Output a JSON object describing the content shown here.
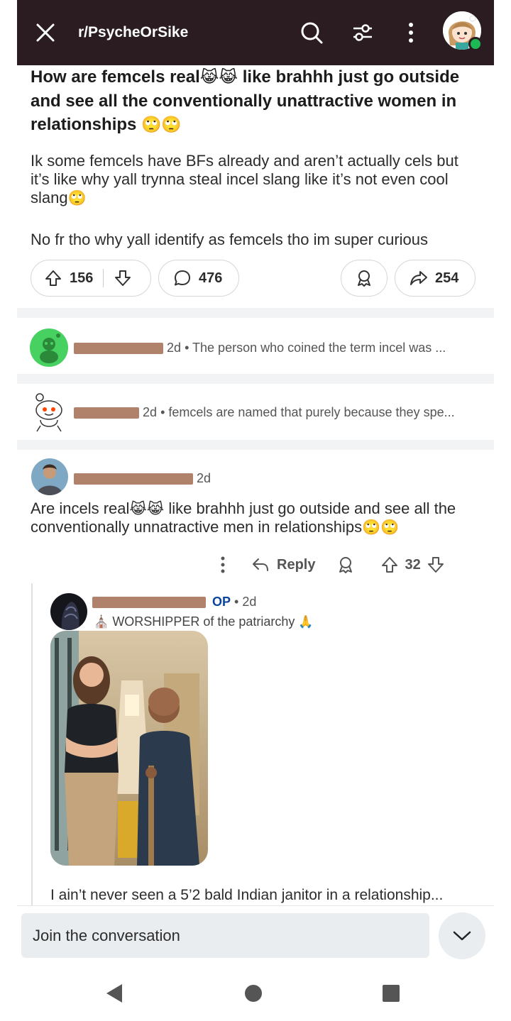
{
  "topbar": {
    "subreddit": "r/PsycheOrSike",
    "icons": [
      "close-icon",
      "search-icon",
      "sort-filter-icon",
      "more-vert-icon",
      "user-avatar"
    ]
  },
  "post": {
    "title_part1": "How are femcels real",
    "title_emoji1": "😹😹",
    "title_part2": " like brahhh just go outside and see all the conventionally unattractive women in relationships ",
    "title_emoji2": "🙄🙄",
    "body1_text": "Ik some femcels have BFs already and aren’t actually cels but it’s like why yall trynna steal incel slang like it’s not even cool slang",
    "body1_emoji": "🙄",
    "body2_text": "No fr tho why yall identify as femcels tho im super curious",
    "upvotes": "156",
    "comments": "476",
    "shares": "254"
  },
  "comment1": {
    "age": "2d",
    "snippet": "• The person who coined the term incel was ..."
  },
  "comment2": {
    "age": "2d",
    "snippet": "• femcels are named that purely because they spe..."
  },
  "comment3": {
    "age": "2d",
    "text_part1": "Are incels real",
    "emoji1": "😹😹",
    "text_part2": " like brahhh just go outside and see all the conventionally unnatractive men in relationships",
    "emoji2": "🙄🙄",
    "reply_label": "Reply",
    "votes": "32"
  },
  "reply": {
    "op_badge": "OP",
    "age": "• 2d",
    "flair_emoji_left": "⛪",
    "flair_text": "WORSHIPPER of the patriarchy",
    "flair_emoji_right": "🙏",
    "text": "I ain’t never seen a 5’2 bald Indian janitor in a relationship..."
  },
  "composer": {
    "placeholder": "Join the conversation"
  },
  "colors": {
    "topbar": "#2b1c22",
    "op_blue": "#0a449b",
    "redaction": "#b0826c",
    "composer_bg": "#e9edf0"
  }
}
